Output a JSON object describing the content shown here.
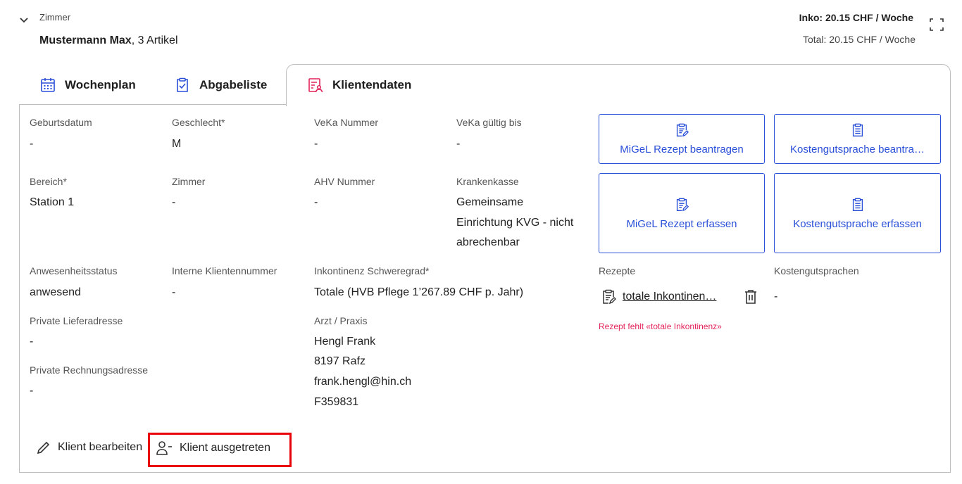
{
  "header": {
    "section_label": "Zimmer",
    "client_name": "Mustermann Max",
    "client_suffix": ", 3 Artikel",
    "inko_cost": "Inko: 20.15 CHF / Woche",
    "total_cost": "Total: 20.15 CHF / Woche"
  },
  "tabs": [
    {
      "label": "Wochenplan",
      "icon": "calendar-icon"
    },
    {
      "label": "Abgabeliste",
      "icon": "clipboard-check-icon"
    },
    {
      "label": "Klientendaten",
      "icon": "client-data-icon",
      "active": true
    }
  ],
  "fields": {
    "geburtsdatum": {
      "label": "Geburtsdatum",
      "value": "-"
    },
    "geschlecht": {
      "label": "Geschlecht*",
      "value": "M"
    },
    "veka_nummer": {
      "label": "VeKa Nummer",
      "value": "-"
    },
    "veka_gueltig": {
      "label": "VeKa gültig bis",
      "value": "-"
    },
    "bereich": {
      "label": "Bereich*",
      "value": "Station 1"
    },
    "zimmer": {
      "label": "Zimmer",
      "value": "-"
    },
    "ahv": {
      "label": "AHV Nummer",
      "value": "-"
    },
    "krankenkasse": {
      "label": "Krankenkasse",
      "value_lines": [
        "Gemeinsame",
        "Einrichtung KVG - nicht",
        "abrechenbar"
      ]
    },
    "anwesenheit": {
      "label": "Anwesenheitsstatus",
      "value": "anwesend"
    },
    "interne_nr": {
      "label": "Interne Klientennummer",
      "value": "-"
    },
    "inkontinenz": {
      "label": "Inkontinenz Schweregrad*",
      "value": "Totale (HVB Pflege 1’267.89 CHF p. Jahr)"
    },
    "lieferadresse": {
      "label": "Private Lieferadresse",
      "value": "-"
    },
    "rechnungsadresse": {
      "label": "Private Rechnungsadresse",
      "value": "-"
    },
    "arzt": {
      "label": "Arzt / Praxis",
      "value_lines": [
        "Hengl Frank",
        "8197 Rafz",
        "frank.hengl@hin.ch",
        "F359831"
      ]
    }
  },
  "actions": {
    "migel_beantragen": "MiGeL Rezept beantragen",
    "kostengutsprache_beantragen": "Kostengutsprache beantra…",
    "migel_erfassen": "MiGeL Rezept erfassen",
    "kostengutsprache_erfassen": "Kostengutsprache erfassen"
  },
  "rezepte": {
    "label": "Rezepte",
    "item": "totale Inkontinen…",
    "warning": "Rezept fehlt «totale Inkontinenz»"
  },
  "kostengutsprachen": {
    "label": "Kostengutsprachen",
    "value": "-"
  },
  "footer": {
    "edit_label": "Klient bearbeiten",
    "exit_label": "Klient ausgetreten"
  },
  "colors": {
    "accent": "#2a4fd8",
    "active_tab_icon": "#e2235a",
    "warning": "#e2235a",
    "highlight": "#e8000b"
  }
}
